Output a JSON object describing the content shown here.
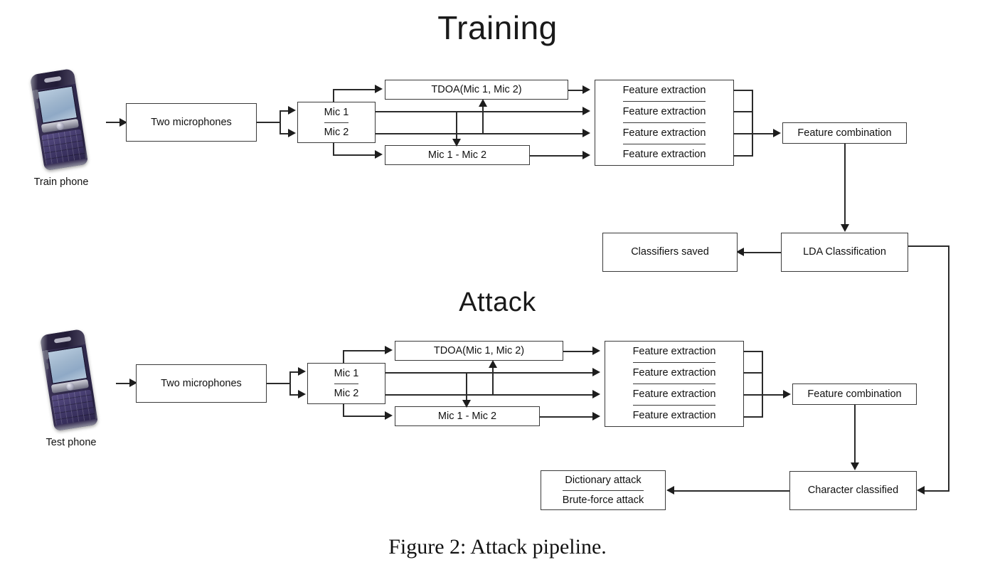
{
  "figure": {
    "caption": "Figure 2:  Attack pipeline."
  },
  "training": {
    "title": "Training",
    "phone_label": "Train phone",
    "two_microphones": "Two microphones",
    "mic1": "Mic 1",
    "mic2": "Mic 2",
    "tdoa": "TDOA(Mic 1, Mic 2)",
    "mic_diff": "Mic 1 - Mic 2",
    "feature_extraction_1": "Feature extraction",
    "feature_extraction_2": "Feature extraction",
    "feature_extraction_3": "Feature extraction",
    "feature_extraction_4": "Feature extraction",
    "feature_combination": "Feature combination",
    "lda_classification": "LDA Classification",
    "classifiers_saved": "Classifiers saved"
  },
  "attack": {
    "title": "Attack",
    "phone_label": "Test phone",
    "two_microphones": "Two microphones",
    "mic1": "Mic 1",
    "mic2": "Mic 2",
    "tdoa": "TDOA(Mic 1, Mic 2)",
    "mic_diff": "Mic 1 - Mic 2",
    "feature_extraction_1": "Feature extraction",
    "feature_extraction_2": "Feature extraction",
    "feature_extraction_3": "Feature extraction",
    "feature_extraction_4": "Feature extraction",
    "feature_combination": "Feature combination",
    "character_classified": "Character classified",
    "dictionary_attack": "Dictionary attack",
    "brute_force_attack": "Brute-force attack"
  },
  "colors": {
    "background": "#ffffff",
    "box_border": "#3a3a3a",
    "connector": "#2b2b2b",
    "text": "#111111",
    "phone_body": "#2e2748",
    "phone_screen": "#9fb6cd"
  }
}
